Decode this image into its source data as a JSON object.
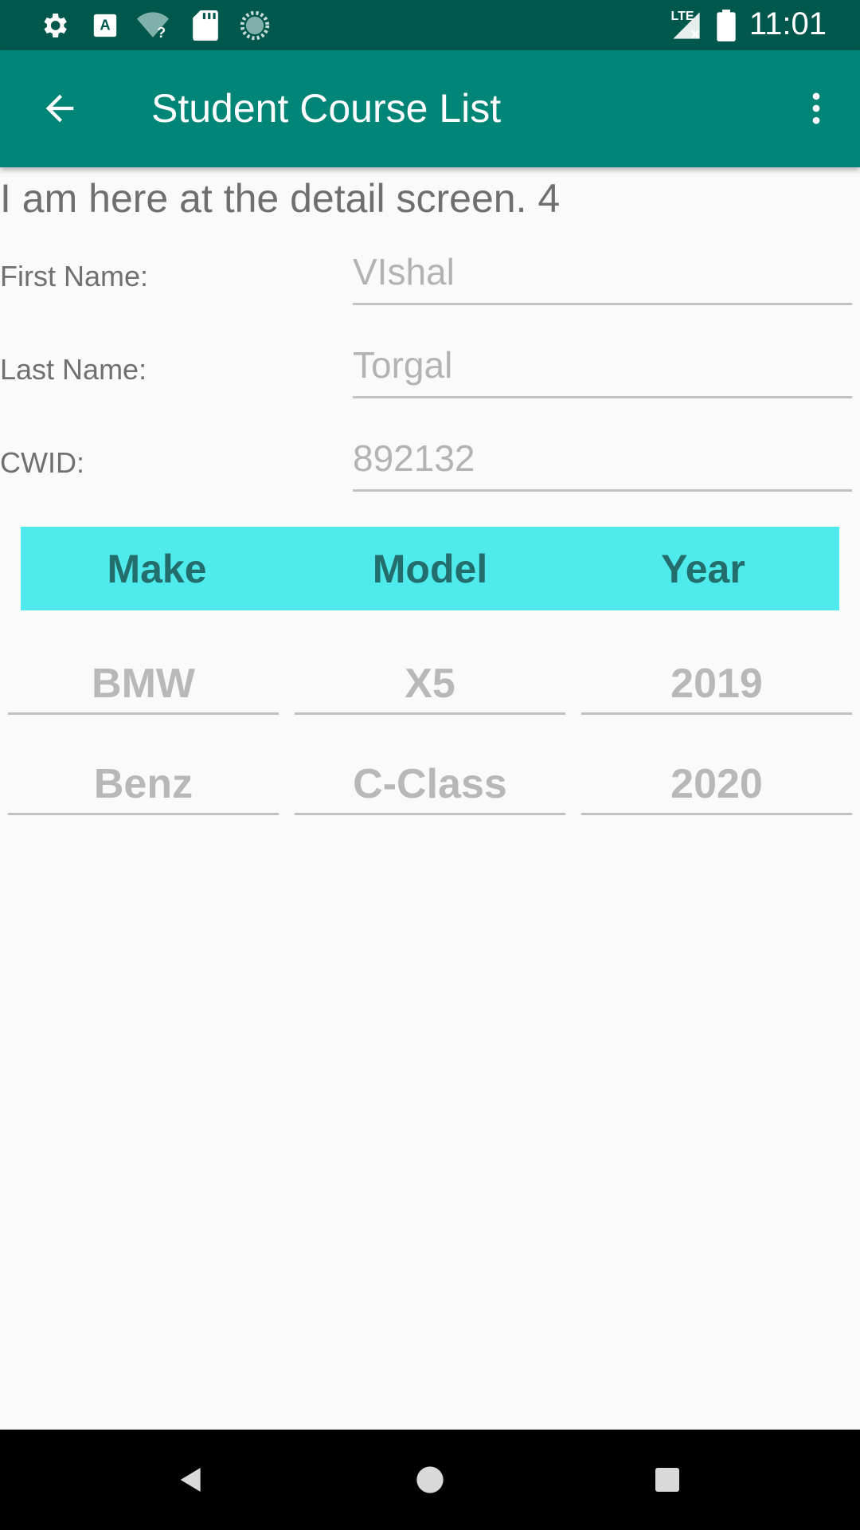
{
  "status_bar": {
    "time": "11:01",
    "network_label": "LTE",
    "icons": [
      "gear-icon",
      "keyboard-a-icon",
      "wifi-unknown-icon",
      "sd-card-icon",
      "sync-circle-icon",
      "signal-icon",
      "battery-icon"
    ]
  },
  "app_bar": {
    "title": "Student Course List",
    "back_icon": "arrow-back-icon",
    "menu_icon": "more-vert-icon"
  },
  "intro_text": "I am here at the detail screen. 4",
  "form": {
    "first_name": {
      "label": "First Name:",
      "value": "VIshal"
    },
    "last_name": {
      "label": "Last Name:",
      "value": "Torgal"
    },
    "cwid": {
      "label": "CWID:",
      "value": "892132"
    }
  },
  "table": {
    "headers": [
      "Make",
      "Model",
      "Year"
    ],
    "header_color": "#4eeaec",
    "rows": [
      [
        "BMW",
        "X5",
        "2019"
      ],
      [
        "Benz",
        "C-Class",
        "2020"
      ]
    ]
  },
  "nav_bar": {
    "icons": [
      "back-triangle-icon",
      "home-circle-icon",
      "recents-square-icon"
    ]
  },
  "colors": {
    "status_bar": "#00574b",
    "app_bar": "#008577"
  }
}
